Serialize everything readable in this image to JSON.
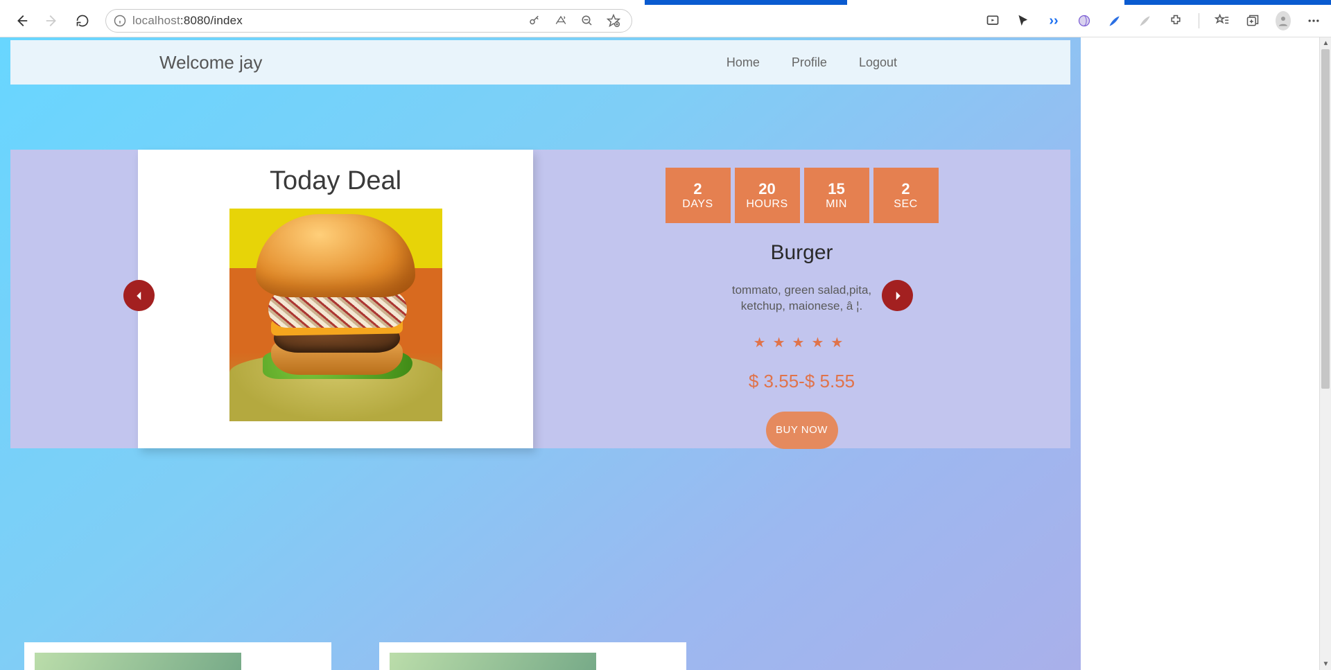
{
  "browser": {
    "url_host": "localhost",
    "url_rest": ":8080/index"
  },
  "nav": {
    "brand": "Welcome jay",
    "links": [
      "Home",
      "Profile",
      "Logout"
    ]
  },
  "deal": {
    "title": "Today Deal",
    "countdown": [
      {
        "num": "2",
        "label": "DAYS"
      },
      {
        "num": "20",
        "label": "HOURS"
      },
      {
        "num": "15",
        "label": "MIN"
      },
      {
        "num": "2",
        "label": "SEC"
      }
    ],
    "product_name": "Burger",
    "description_l1": "tommato, green salad,pita,",
    "description_l2": "ketchup, maionese, â ¦.",
    "rating": 5,
    "price": "$ 3.55-$ 5.55",
    "buy_label": "BUY NOW"
  }
}
